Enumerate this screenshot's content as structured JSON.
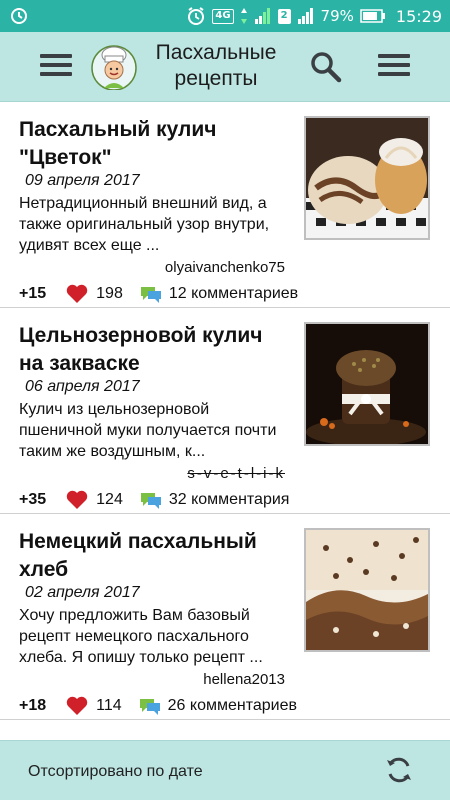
{
  "status_bar": {
    "network_label": "4G",
    "sim_label": "2",
    "battery": "79%",
    "time": "15:29"
  },
  "app_bar": {
    "title_line1": "Пасхальные",
    "title_line2": "рецепты"
  },
  "recipes": [
    {
      "title_line1": "Пасхальный кулич",
      "title_line2": "\"Цветок\"",
      "date": "09 апреля 2017",
      "description": "Нетрадиционный внешний вид, а также оригинальный узор внутри, удивят всех еще ...",
      "author": "olyaivanchenko75",
      "score": "+15",
      "likes": "198",
      "comments": "12 комментариев"
    },
    {
      "title_line1": "Цельнозерновой кулич",
      "title_line2": "на закваске",
      "date": "06 апреля 2017",
      "description": "Кулич из цельнозерновой пшеничной муки получается почти таким же воздушным, к...",
      "author": "s-v-e-t-l-i-k",
      "score": "+35",
      "likes": "124",
      "comments": "32 комментария"
    },
    {
      "title_line1": "Немецкий пасхальный",
      "title_line2": "хлеб",
      "date": "02 апреля 2017",
      "description": "Хочу предложить Вам базовый рецепт немецкого пасхального хлеба. Я опишу только рецепт ...",
      "author": "hellena2013",
      "score": "+18",
      "likes": "114",
      "comments": "26 комментариев"
    }
  ],
  "bottom_bar": {
    "sort_label": "Отсортировано по дате"
  },
  "colors": {
    "status_bar": "#2bb3a6",
    "app_bar": "#bde6e3",
    "heart": "#d0212b",
    "comment_green": "#7bc043",
    "comment_blue": "#4aa3df"
  }
}
